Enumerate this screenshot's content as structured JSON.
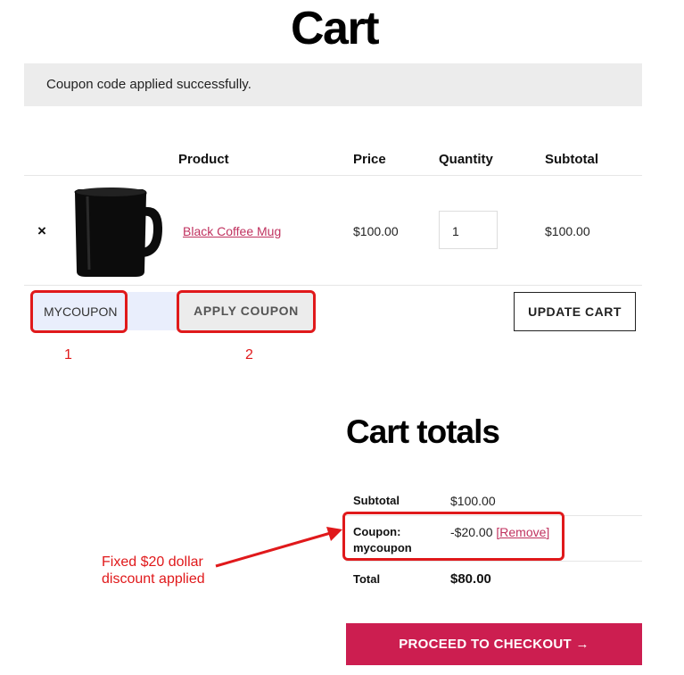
{
  "page": {
    "title": "Cart"
  },
  "notice": {
    "message": "Coupon code applied successfully."
  },
  "table": {
    "headers": {
      "product": "Product",
      "price": "Price",
      "quantity": "Quantity",
      "subtotal": "Subtotal"
    },
    "rows": [
      {
        "remove_icon": "×",
        "product_name": "Black Coffee Mug",
        "price": "$100.00",
        "quantity": "1",
        "subtotal": "$100.00"
      }
    ]
  },
  "coupon": {
    "value": "MYCOUPON",
    "apply_label": "APPLY COUPON"
  },
  "actions": {
    "update_label": "UPDATE CART"
  },
  "annotations": {
    "step1": "1",
    "step2": "2",
    "note_line1": "Fixed $20 dollar",
    "note_line2": "discount applied"
  },
  "totals": {
    "title": "Cart totals",
    "subtotal_label": "Subtotal",
    "subtotal_value": "$100.00",
    "coupon_label_line1": "Coupon:",
    "coupon_label_line2": "mycoupon",
    "coupon_value": "-$20.00",
    "coupon_remove": "[Remove]",
    "total_label": "Total",
    "total_value": "$80.00"
  },
  "checkout": {
    "label": "PROCEED TO CHECKOUT →"
  },
  "colors": {
    "accent": "#cc1e50",
    "link": "#c0325f",
    "annotation": "#e0191b",
    "notice_bg": "#ececec"
  },
  "icons": {
    "remove": "close-icon",
    "arrow": "arrow-right-icon"
  }
}
